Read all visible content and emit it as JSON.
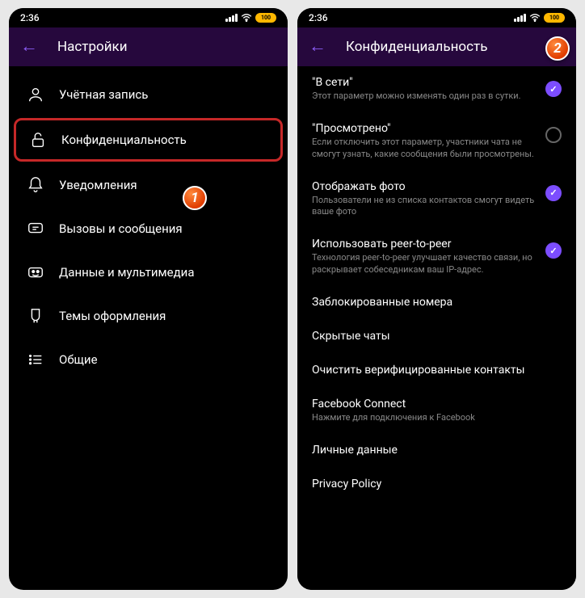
{
  "status": {
    "time": "2:36",
    "battery": "100"
  },
  "screen1": {
    "title": "Настройки",
    "items": [
      {
        "icon": "user",
        "label": "Учётная запись"
      },
      {
        "icon": "lock",
        "label": "Конфиденциальность"
      },
      {
        "icon": "bell",
        "label": "Уведомления"
      },
      {
        "icon": "chat",
        "label": "Вызовы и сообщения"
      },
      {
        "icon": "media",
        "label": "Данные и мультимедиа"
      },
      {
        "icon": "theme",
        "label": "Темы оформления"
      },
      {
        "icon": "list",
        "label": "Общие"
      }
    ],
    "badge": "1"
  },
  "screen2": {
    "title": "Конфиденциальность",
    "badge": "2",
    "items": [
      {
        "title": "\"В сети\"",
        "desc": "Этот параметр можно изменять один раз в сутки.",
        "checked": true
      },
      {
        "title": "\"Просмотрено\"",
        "desc": "Если отключить этот параметр, участники чата не смогут узнать, какие сообщения были просмотрены.",
        "checked": false
      },
      {
        "title": "Отображать фото",
        "desc": "Пользователи не из списка контактов смогут видеть ваше фото",
        "checked": true
      },
      {
        "title": "Использовать peer-to-peer",
        "desc": "Технология peer-to-peer улучшает качество связи, но раскрывает собеседникам ваш IP-адрес.",
        "checked": true
      },
      {
        "title": "Заблокированные номера",
        "desc": ""
      },
      {
        "title": "Скрытые чаты",
        "desc": ""
      },
      {
        "title": "Очистить верифицированные контакты",
        "desc": ""
      },
      {
        "title": "Facebook Connect",
        "desc": "Нажмите для подключения к Facebook"
      },
      {
        "title": "Личные данные",
        "desc": ""
      },
      {
        "title": "Privacy Policy",
        "desc": ""
      }
    ]
  }
}
